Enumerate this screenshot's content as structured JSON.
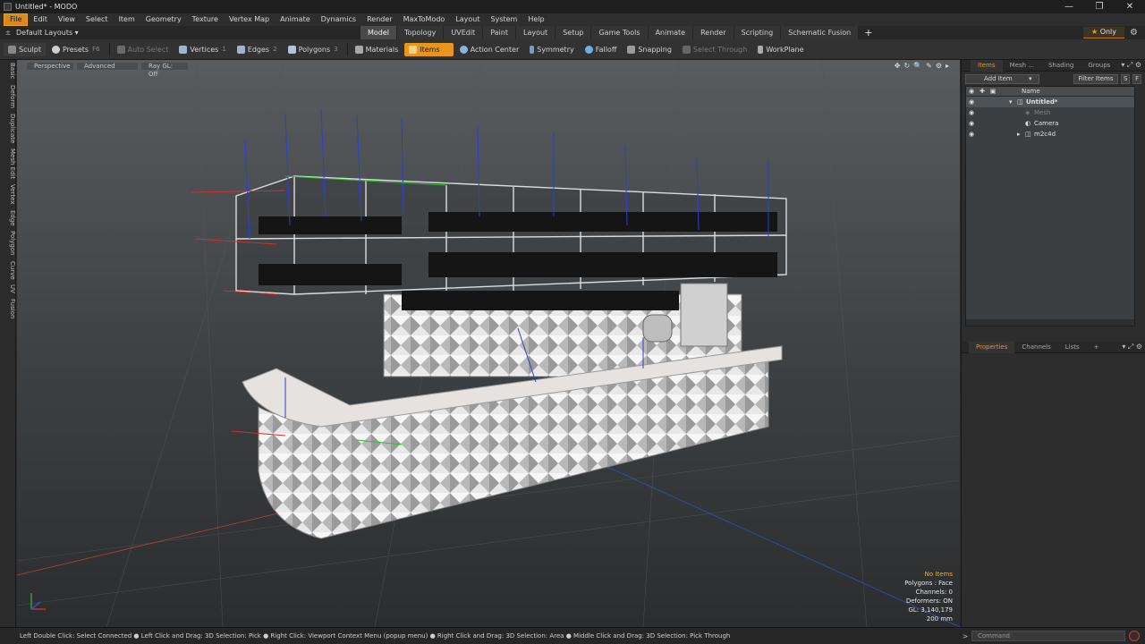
{
  "window": {
    "title": "Untitled* - MODO",
    "controls": [
      "—",
      "❐",
      "✕"
    ]
  },
  "menu": [
    "File",
    "Edit",
    "View",
    "Select",
    "Item",
    "Geometry",
    "Texture",
    "Vertex Map",
    "Animate",
    "Dynamics",
    "Render",
    "MaxToModo",
    "Layout",
    "System",
    "Help"
  ],
  "layouts": {
    "label": "Default Layouts ▾",
    "pin": "±"
  },
  "tabs": [
    "Model",
    "Topology",
    "UVEdit",
    "Paint",
    "Layout",
    "Setup",
    "Game Tools",
    "Animate",
    "Render",
    "Scripting",
    "Schematic Fusion"
  ],
  "tabs_plus": "+",
  "only_label": "Only",
  "only_star": "★",
  "gear_icon": "⚙",
  "toolbar": {
    "sculpt": "Sculpt",
    "presets": "Presets",
    "presets_key": "F6",
    "auto_select": "Auto Select",
    "vertices": "Vertices",
    "vertices_key": "1",
    "edges": "Edges",
    "edges_key": "2",
    "polygons": "Polygons",
    "polygons_key": "3",
    "materials": "Materials",
    "items": "Items",
    "action_center": "Action Center",
    "symmetry": "Symmetry",
    "falloff": "Falloff",
    "snapping": "Snapping",
    "select_through": "Select Through",
    "workplane": "WorkPlane"
  },
  "left_tabs": [
    "Basic",
    "Deform",
    "Duplicate",
    "Mesh Edit",
    "Vertex",
    "Edge",
    "Polygon",
    "Curve",
    "UV",
    "Fusion"
  ],
  "viewport": {
    "perspective": "Perspective",
    "advanced": "Advanced",
    "raygl": "Ray GL: Off",
    "icons": [
      "✥",
      "↻",
      "🔍",
      "✎",
      "⚙",
      "▸"
    ],
    "info": {
      "no_items": "No Items",
      "polygons": "Polygons : Face",
      "channels": "Channels: 0",
      "deformers": "Deformers: ON",
      "gl": "GL: 3,140,179",
      "scale": "200 mm"
    }
  },
  "status": {
    "hint": "Left Double Click: Select Connected ● Left Click and Drag: 3D Selection: Pick ● Right Click: Viewport Context Menu (popup menu) ● Right Click and Drag: 3D Selection: Area ● Middle Click and Drag: 3D Selection: Pick Through",
    "command_arrow": ">",
    "command_placeholder": "Command"
  },
  "items_panel": {
    "tabs": [
      "Items",
      "Mesh ...",
      "Shading",
      "Groups"
    ],
    "tab_icons": "▾ ⤢ ⚙",
    "add_item": "Add Item",
    "add_item_arrow": "▾",
    "filter_items": "Filter Items",
    "s_btn": "S",
    "f_btn": "F",
    "name_header": "Name",
    "rows": [
      {
        "label": "Untitled*",
        "indent": 0,
        "arrow": "▾",
        "icon": "◫",
        "bold": true
      },
      {
        "label": "Mesh",
        "indent": 1,
        "arrow": "",
        "icon": "◈",
        "dim": true
      },
      {
        "label": "Camera",
        "indent": 1,
        "arrow": "",
        "icon": "◐"
      },
      {
        "label": "m2c4d",
        "indent": 1,
        "arrow": "▸",
        "icon": "◫"
      }
    ]
  },
  "props_panel": {
    "tabs": [
      "Properties",
      "Channels",
      "Lists"
    ],
    "plus": "+",
    "tab_icons": "▾ ⤢ ⚙"
  }
}
